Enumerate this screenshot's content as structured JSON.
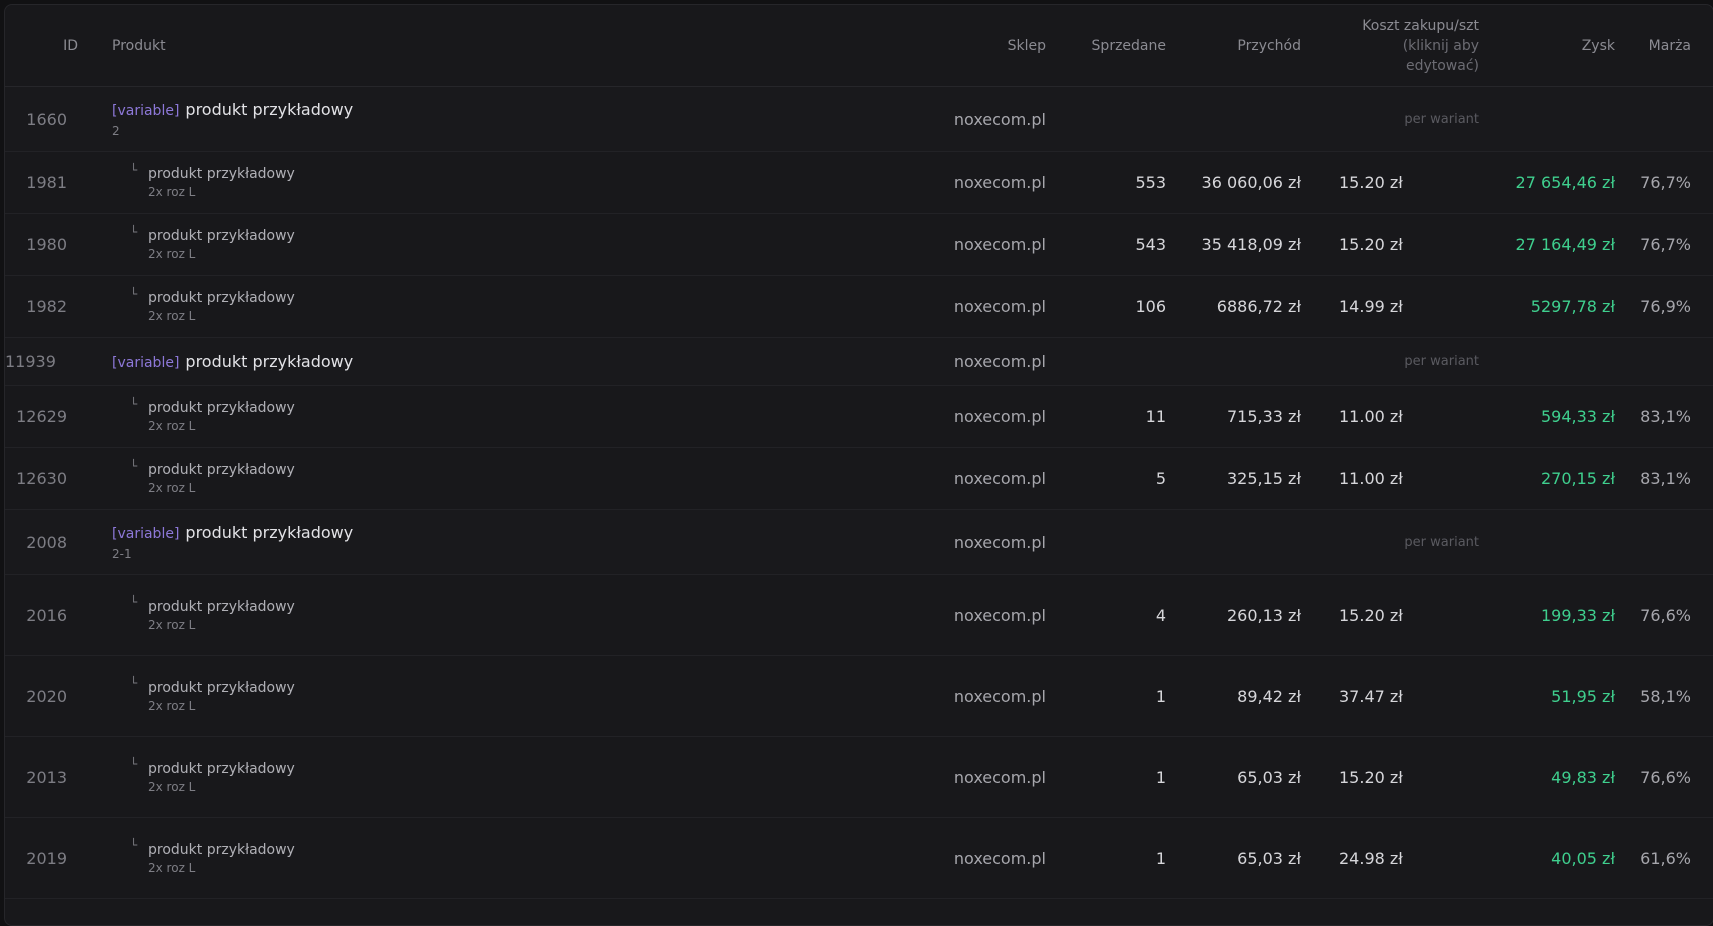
{
  "headers": {
    "id": "ID",
    "product": "Produkt",
    "shop": "Sklep",
    "sold": "Sprzedane",
    "revenue": "Przychód",
    "cost_line1": "Koszt zakupu/szt",
    "cost_line2": "(kliknij aby",
    "cost_line3": "edytować)",
    "profit": "Zysk",
    "margin": "Marża"
  },
  "colors": {
    "profit": "#3fcf8e",
    "variable_tag": "#8d78d8"
  },
  "branch_icon": "└",
  "groups": [
    {
      "id": "1660",
      "tag": "[variable]",
      "title": "produkt przykładowy",
      "sub": "2",
      "shop": "noxecom.pl",
      "note": "per wariant",
      "children": [
        {
          "id": "1981",
          "title": "produkt przykładowy",
          "sub": "2x roz L",
          "shop": "noxecom.pl",
          "sold": "553",
          "revenue": "36 060,06 zł",
          "cost": "15.20 zł",
          "profit": "27 654,46 zł",
          "margin": "76,7%"
        },
        {
          "id": "1980",
          "title": "produkt przykładowy",
          "sub": "2x roz L",
          "shop": "noxecom.pl",
          "sold": "543",
          "revenue": "35 418,09 zł",
          "cost": "15.20 zł",
          "profit": "27 164,49 zł",
          "margin": "76,7%"
        },
        {
          "id": "1982",
          "title": "produkt przykładowy",
          "sub": "2x roz L",
          "shop": "noxecom.pl",
          "sold": "106",
          "revenue": "6886,72 zł",
          "cost": "14.99 zł",
          "profit": "5297,78 zł",
          "margin": "76,9%"
        }
      ]
    },
    {
      "id": "11939",
      "tag": "[variable]",
      "title": "produkt przykładowy",
      "sub": "",
      "shop": "noxecom.pl",
      "note": "per wariant",
      "children": [
        {
          "id": "12629",
          "title": "produkt przykładowy",
          "sub": "2x roz L",
          "shop": "noxecom.pl",
          "sold": "11",
          "revenue": "715,33 zł",
          "cost": "11.00 zł",
          "profit": "594,33 zł",
          "margin": "83,1%"
        },
        {
          "id": "12630",
          "title": "produkt przykładowy",
          "sub": "2x roz L",
          "shop": "noxecom.pl",
          "sold": "5",
          "revenue": "325,15 zł",
          "cost": "11.00 zł",
          "profit": "270,15 zł",
          "margin": "83,1%"
        }
      ]
    },
    {
      "id": "2008",
      "tag": "[variable]",
      "title": "produkt przykładowy",
      "sub": "2-1",
      "shop": "noxecom.pl",
      "note": "per wariant",
      "children": [
        {
          "id": "2016",
          "title": "produkt przykładowy",
          "sub": "2x roz L",
          "shop": "noxecom.pl",
          "sold": "4",
          "revenue": "260,13 zł",
          "cost": "15.20 zł",
          "profit": "199,33 zł",
          "margin": "76,6%"
        },
        {
          "id": "2020",
          "title": "produkt przykładowy",
          "sub": "2x roz L",
          "shop": "noxecom.pl",
          "sold": "1",
          "revenue": "89,42 zł",
          "cost": "37.47 zł",
          "profit": "51,95 zł",
          "margin": "58,1%"
        },
        {
          "id": "2013",
          "title": "produkt przykładowy",
          "sub": "2x roz L",
          "shop": "noxecom.pl",
          "sold": "1",
          "revenue": "65,03 zł",
          "cost": "15.20 zł",
          "profit": "49,83 zł",
          "margin": "76,6%"
        },
        {
          "id": "2019",
          "title": "produkt przykładowy",
          "sub": "2x roz L",
          "shop": "noxecom.pl",
          "sold": "1",
          "revenue": "65,03 zł",
          "cost": "24.98 zł",
          "profit": "40,05 zł",
          "margin": "61,6%"
        }
      ]
    }
  ]
}
